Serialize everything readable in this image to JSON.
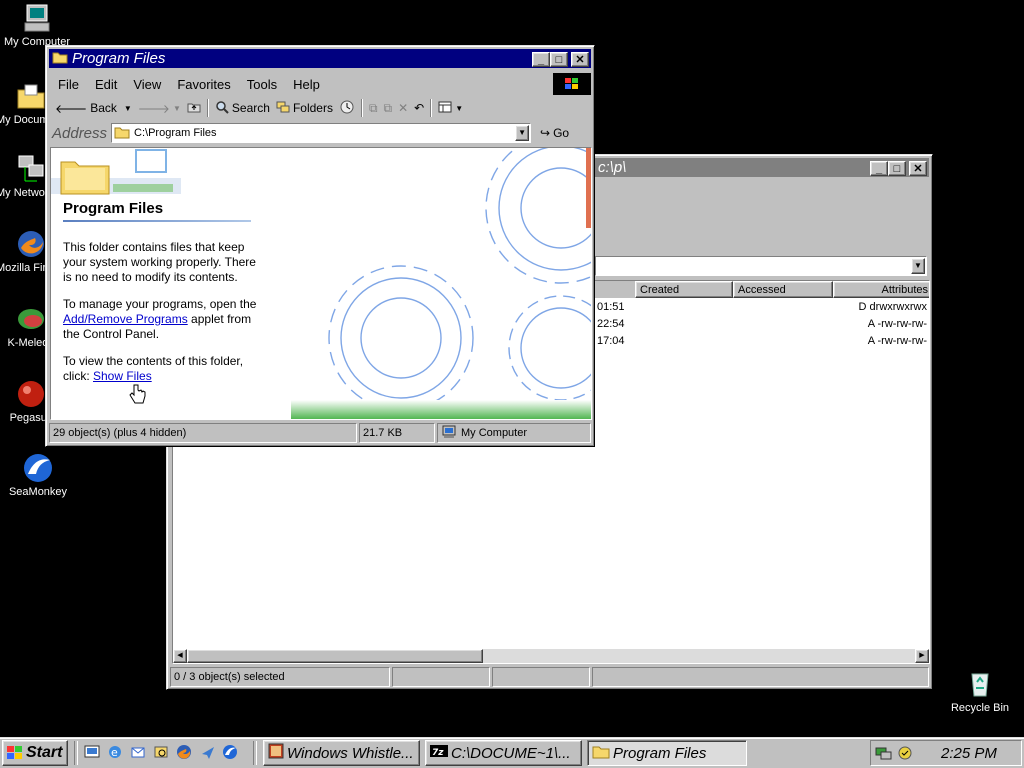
{
  "desktop": {
    "icons": [
      {
        "label": "My Computer"
      },
      {
        "label": "My Documents"
      },
      {
        "label": "My Network Places"
      },
      {
        "label": "Mozilla Firefox"
      },
      {
        "label": "K-Meleon"
      },
      {
        "label": "Pegasus"
      },
      {
        "label": "SeaMonkey"
      },
      {
        "label": "Recycle Bin"
      }
    ]
  },
  "back_window": {
    "title": "c:\\p\\",
    "columns": [
      "Created",
      "Accessed",
      "Attributes"
    ],
    "rows": [
      {
        "time": "01:51",
        "attributes": "D drwxrwxrwx"
      },
      {
        "time": "22:54",
        "attributes": "A -rw-rw-rw-"
      },
      {
        "time": "17:04",
        "attributes": "A -rw-rw-rw-"
      }
    ],
    "status": "0 / 3 object(s) selected"
  },
  "front_window": {
    "title": "Program Files",
    "menu": [
      "File",
      "Edit",
      "View",
      "Favorites",
      "Tools",
      "Help"
    ],
    "toolbar": {
      "back": "Back",
      "search": "Search",
      "folders": "Folders"
    },
    "address_label": "Address",
    "address_value": "C:\\Program Files",
    "go_label": "Go",
    "heading": "Program Files",
    "para1": "This folder contains files that keep your system working properly. There is no need to modify its contents.",
    "para2_before": "To manage your programs, open the ",
    "para2_link": "Add/Remove Programs",
    "para2_after": " applet from the Control Panel.",
    "para3_before": "To view the contents of this folder, click: ",
    "para3_link": "Show Files",
    "status_objects": "29 object(s) (plus 4 hidden)",
    "status_size": "21.7 KB",
    "status_zone": "My Computer"
  },
  "taskbar": {
    "start_label": "Start",
    "tasks": [
      {
        "label": "Windows Whistle..."
      },
      {
        "label": "C:\\DOCUME~1\\..."
      },
      {
        "label": "Program Files"
      }
    ],
    "clock": "2:25 PM"
  },
  "colors": {
    "title_active": "#000080",
    "title_inactive": "#808080",
    "face": "#c0c0c0",
    "desktop": "#000000"
  }
}
